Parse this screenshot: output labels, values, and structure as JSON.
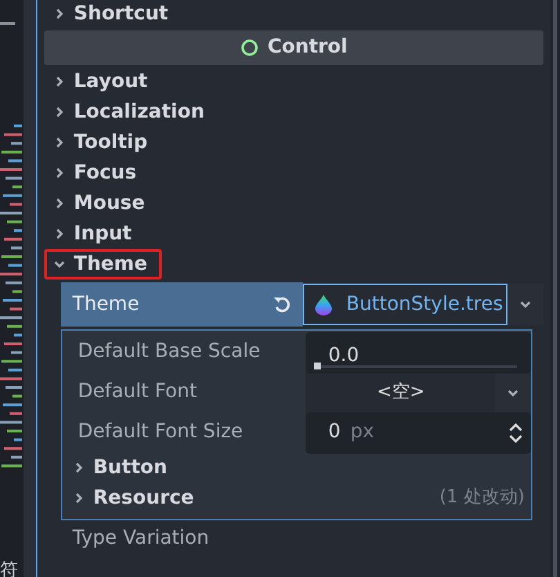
{
  "left_panel": {
    "text": "符"
  },
  "sections": [
    {
      "label": "Shortcut",
      "expanded": false
    }
  ],
  "category": {
    "title": "Control"
  },
  "groups": [
    {
      "label": "Layout",
      "expanded": false,
      "highlighted": false
    },
    {
      "label": "Localization",
      "expanded": false,
      "highlighted": false
    },
    {
      "label": "Tooltip",
      "expanded": false,
      "highlighted": false
    },
    {
      "label": "Focus",
      "expanded": false,
      "highlighted": false
    },
    {
      "label": "Mouse",
      "expanded": false,
      "highlighted": false
    },
    {
      "label": "Input",
      "expanded": false,
      "highlighted": false
    },
    {
      "label": "Theme",
      "expanded": true,
      "highlighted": true
    }
  ],
  "theme_property": {
    "label": "Theme",
    "resource": "ButtonStyle.tres"
  },
  "sub_properties": [
    {
      "kind": "slider",
      "label": "Default Base Scale",
      "value": "0.0",
      "level": 0
    },
    {
      "kind": "dropdown",
      "label": "Default Font",
      "value": "<空>"
    },
    {
      "kind": "spin",
      "label": "Default Font Size",
      "value": "0",
      "unit": "px"
    }
  ],
  "sub_groups": [
    {
      "label": "Button"
    },
    {
      "label": "Resource",
      "note": "(1 处改动)"
    }
  ],
  "next_property": {
    "label": "Type Variation"
  }
}
